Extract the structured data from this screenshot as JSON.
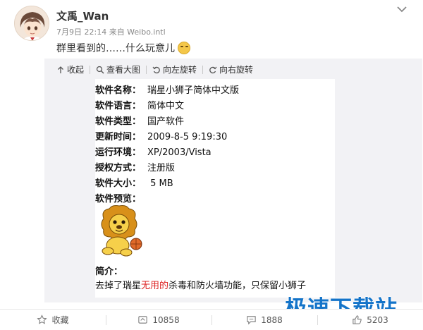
{
  "post": {
    "username": "文禹_Wan",
    "meta": "7月9日 22:14 来自 Weibo.intl",
    "text": "群里看到的……什么玩意儿"
  },
  "icons": {
    "avatar": "avatar-anime-icon",
    "emoji": "laughing-emoji-icon",
    "more": "chevron-down-icon",
    "collapse": "arrow-up-icon",
    "view_large": "magnify-icon",
    "rotate_left": "rotate-left-icon",
    "rotate_right": "rotate-right-icon",
    "favorite": "star-icon",
    "repost": "repost-icon",
    "comment": "comment-icon",
    "like": "thumbs-up-icon"
  },
  "toolbar": {
    "collapse": "收起",
    "view_large": "查看大图",
    "rotate_left": "向左旋转",
    "rotate_right": "向右旋转"
  },
  "image_content": {
    "rows": [
      {
        "key": "软件名称：",
        "value": "瑞星小狮子简体中文版"
      },
      {
        "key": "软件语言：",
        "value": "简体中文"
      },
      {
        "key": "软件类型：",
        "value": "国产软件"
      },
      {
        "key": "更新时间：",
        "value": "2009-8-5 9:19:30"
      },
      {
        "key": "运行环境：",
        "value": "XP/2003/Vista"
      },
      {
        "key": "授权方式：",
        "value": "注册版"
      },
      {
        "key": "软件大小：",
        "value": " 5 MB"
      },
      {
        "key": "软件预览：",
        "value": ""
      }
    ],
    "desc_label": "简介：",
    "desc_part1": "去掉了瑞星",
    "desc_part2": "无用的",
    "desc_part3": "杀毒和防火墙功能，只保留小狮子"
  },
  "watermark": "极速下载站",
  "actions": {
    "favorite": "收藏",
    "repost": "10858",
    "comment": "1888",
    "like": "5203"
  },
  "colors": {
    "accent_red": "#dd2222",
    "watermark_blue": "#1474c9",
    "content_bg": "#f2f2f5"
  }
}
